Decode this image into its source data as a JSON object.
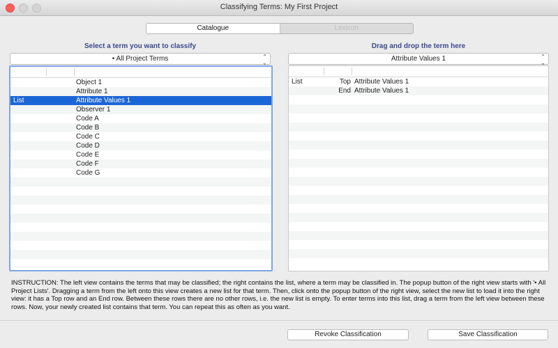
{
  "window": {
    "title": "Classifying Terms: My First Project"
  },
  "tabs": [
    {
      "label": "Catalogue",
      "active": true
    },
    {
      "label": "Lexicon",
      "active": false
    }
  ],
  "left_pane": {
    "heading": "Select a term you want to classify",
    "popup_value": "• All Project Terms",
    "rows": [
      {
        "col1": "",
        "col2": "Object 1",
        "selected": false
      },
      {
        "col1": "",
        "col2": "Attribute 1",
        "selected": false
      },
      {
        "col1": "List",
        "col2": "Attribute Values 1",
        "selected": true
      },
      {
        "col1": "",
        "col2": "Observer 1",
        "selected": false
      },
      {
        "col1": "",
        "col2": "Code A",
        "selected": false
      },
      {
        "col1": "",
        "col2": "Code B",
        "selected": false
      },
      {
        "col1": "",
        "col2": "Code C",
        "selected": false
      },
      {
        "col1": "",
        "col2": "Code D",
        "selected": false
      },
      {
        "col1": "",
        "col2": "Code E",
        "selected": false
      },
      {
        "col1": "",
        "col2": "Code F",
        "selected": false
      },
      {
        "col1": "",
        "col2": "Code G",
        "selected": false
      }
    ]
  },
  "right_pane": {
    "heading": "Drag and drop the term here",
    "popup_value": "Attribute Values 1",
    "rows": [
      {
        "col1": "List",
        "col2": "Top",
        "col3": "Attribute Values 1"
      },
      {
        "col1": "",
        "col2": "End",
        "col3": "Attribute Values 1"
      }
    ]
  },
  "instruction": "INSTRUCTION: The left view contains the terms that may be classified; the right contains the list, where a term may be classified in. The popup button of the right view starts with '• All Project Lists'. Dragging a term from the left onto this view creates a new list for that term. Then, click onto the popup button of the right view, select the new list to load it into the right view: it has a Top row and an End row. Between these rows there are no other rows, i.e. the new list is empty. To enter terms into this list, drag a term from the left view between these rows. Now, your newly created list contains that term. You can repeat this as often as you want.",
  "buttons": {
    "revoke": "Revoke Classification",
    "save": "Save Classification"
  }
}
